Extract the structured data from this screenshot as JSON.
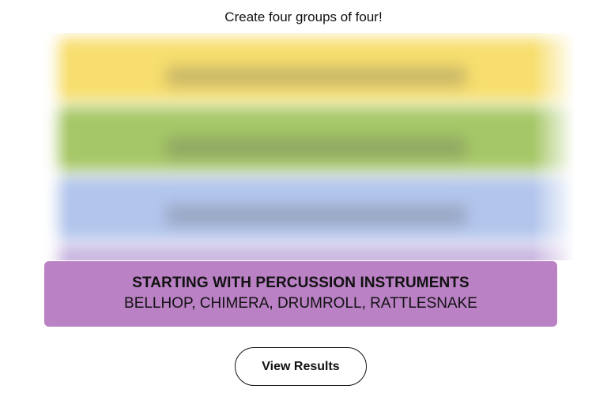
{
  "instructions": "Create four groups of four!",
  "board": {
    "hidden_group_colors": [
      "#f7de6e",
      "#a6c767",
      "#b2c5ec"
    ]
  },
  "solved_group": {
    "color": "#ba81c5",
    "category": "STARTING WITH PERCUSSION INSTRUMENTS",
    "words": "BELLHOP, CHIMERA, DRUMROLL, RATTLESNAKE"
  },
  "view_results_label": "View Results"
}
